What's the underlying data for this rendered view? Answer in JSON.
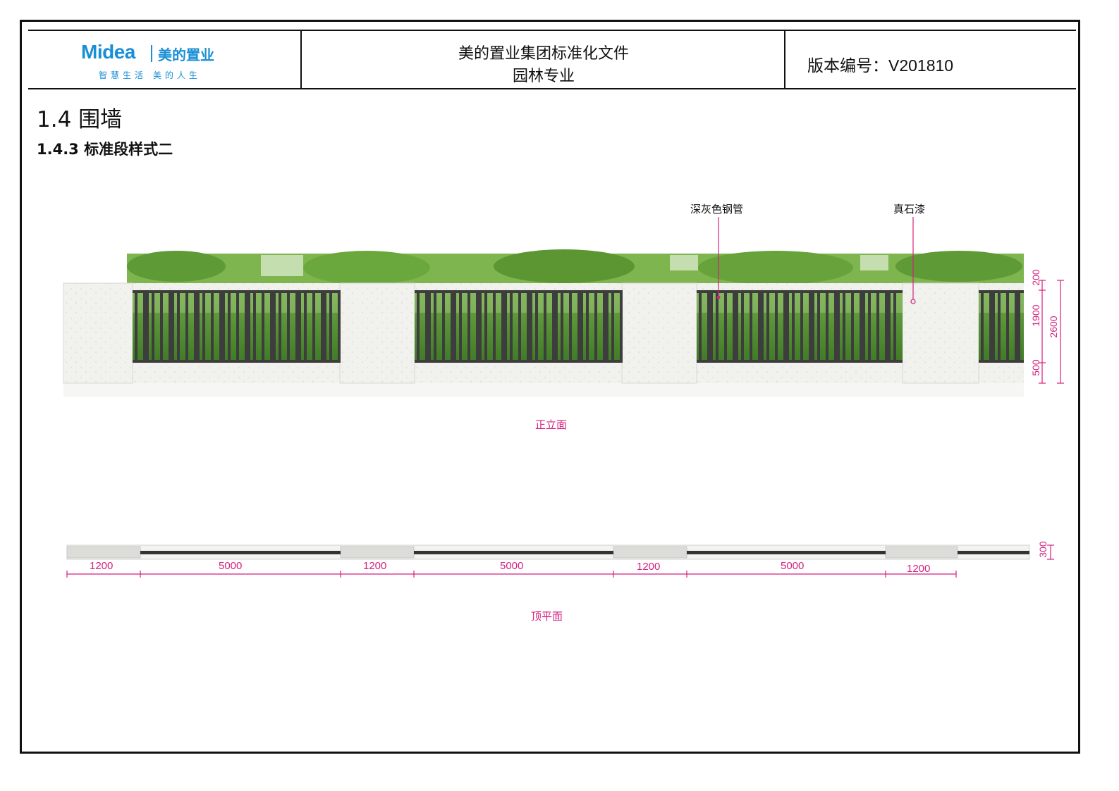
{
  "header": {
    "logo_brand": "Midea",
    "logo_cn": "美的置业",
    "logo_slogan": "智慧生活 美的人生",
    "title_line1": "美的置业集团标准化文件",
    "title_line2": "园林专业",
    "version_label": "版本编号：",
    "version_value": "V201810"
  },
  "section": {
    "title": "1.4 围墙",
    "subtitle": "1.4.3 标准段样式二"
  },
  "elevation": {
    "caption": "正立面",
    "callouts": [
      "深灰色钢管",
      "真石漆"
    ],
    "heights": [
      "200",
      "1900",
      "500",
      "2600"
    ]
  },
  "plan": {
    "caption": "顶平面",
    "width_dims": [
      "1200",
      "5000",
      "1200",
      "5000",
      "1200",
      "5000",
      "1200"
    ],
    "depth_dim": "300"
  },
  "colors": {
    "brand": "#1a8fd6",
    "annotation": "#d4207f",
    "steel": "#3d3d3d",
    "foliage": "#4f8f2e"
  },
  "icons": [
    "midea-logo-icon"
  ]
}
